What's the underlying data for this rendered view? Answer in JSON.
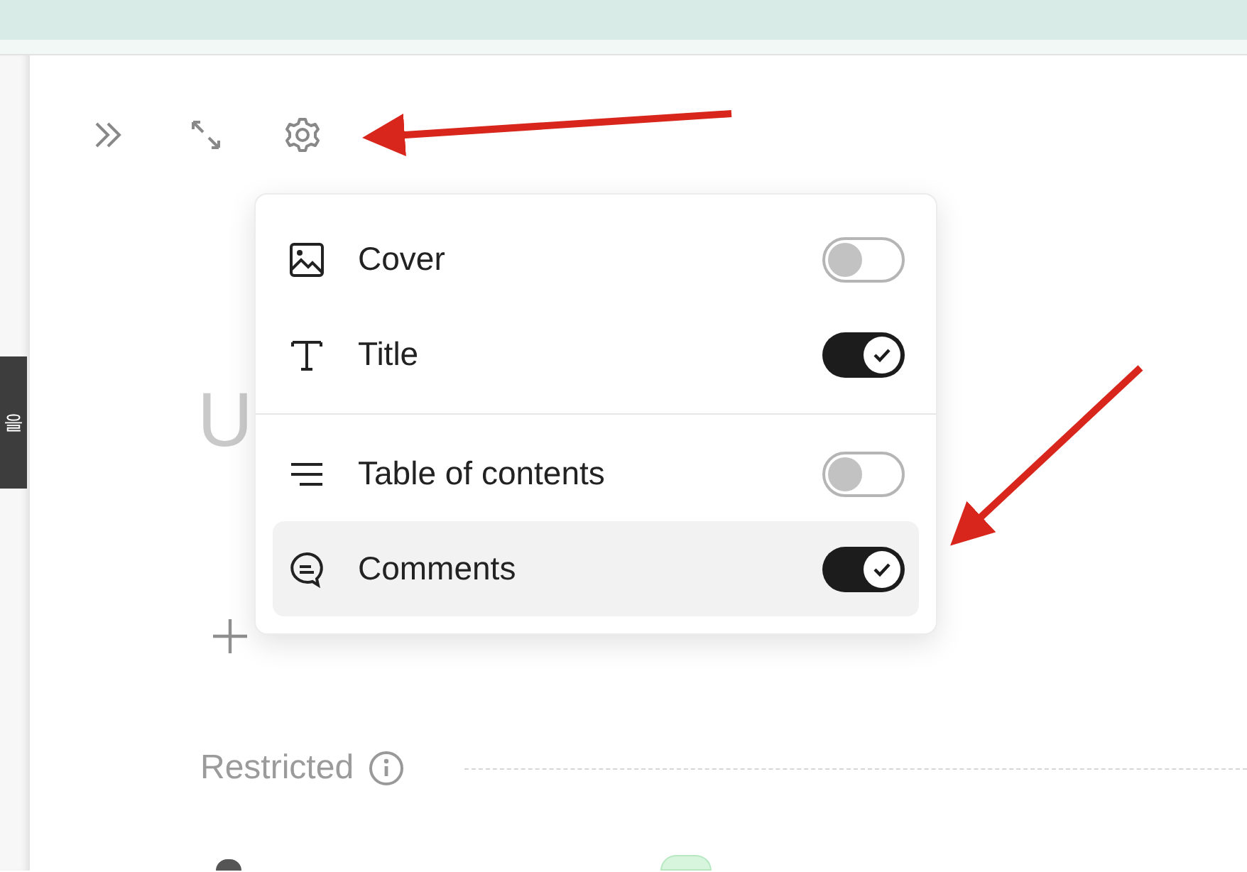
{
  "side_tab": {
    "label": "을"
  },
  "toolbar": [
    {
      "kind": "chevrons"
    },
    {
      "kind": "expand"
    },
    {
      "kind": "settings"
    }
  ],
  "page": {
    "title_placeholder": "U",
    "restricted": {
      "label": "Restricted"
    }
  },
  "settings_menu": {
    "sections": [
      {
        "items": [
          {
            "kind": "image",
            "label": "Cover",
            "on": false,
            "highlighted": false
          },
          {
            "kind": "title",
            "label": "Title",
            "on": true,
            "highlighted": false
          }
        ]
      },
      {
        "items": [
          {
            "kind": "toc",
            "label": "Table of contents",
            "on": false,
            "highlighted": false
          },
          {
            "kind": "comment",
            "label": "Comments",
            "on": true,
            "highlighted": true
          }
        ]
      }
    ]
  }
}
